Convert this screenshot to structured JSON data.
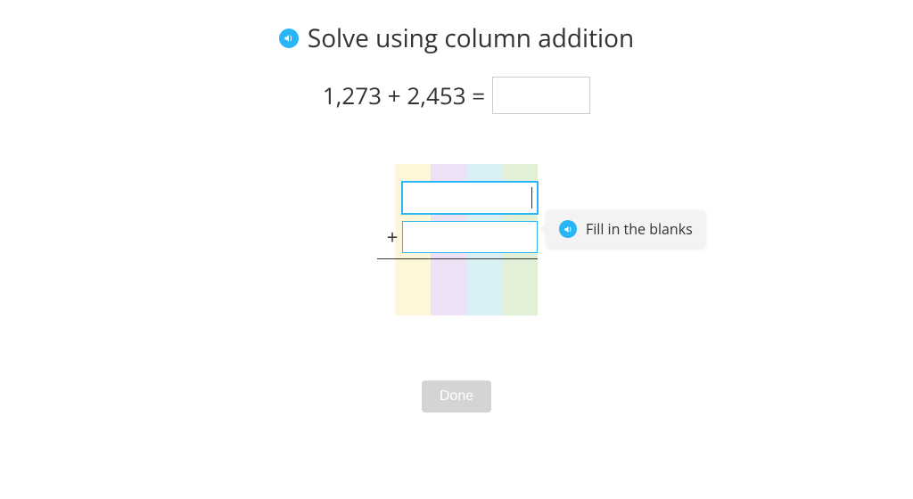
{
  "title": "Solve using column addition",
  "equation": {
    "expression": "1,273 + 2,453 =",
    "answer_value": ""
  },
  "addition": {
    "plus": "+",
    "addend1_value": "",
    "addend2_value": ""
  },
  "tooltip": {
    "text": "Fill in the blanks"
  },
  "buttons": {
    "done": "Done"
  }
}
